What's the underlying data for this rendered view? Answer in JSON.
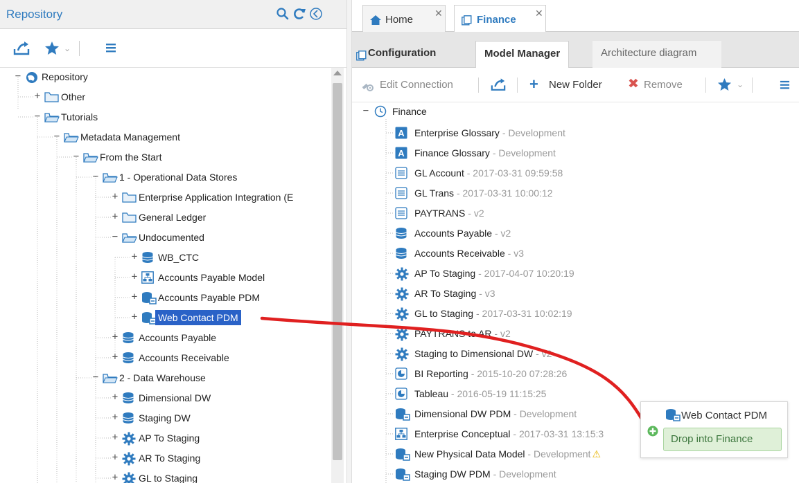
{
  "left_panel": {
    "title": "Repository",
    "tree": [
      {
        "label": "Repository",
        "icon": "repository-globe-icon"
      },
      {
        "label": "Other",
        "icon": "folder-icon"
      },
      {
        "label": "Tutorials",
        "icon": "folder-open-icon"
      },
      {
        "label": "Metadata Management",
        "icon": "folder-open-icon"
      },
      {
        "label": "From the Start",
        "icon": "folder-open-icon"
      },
      {
        "label": "1 - Operational Data Stores",
        "icon": "folder-open-icon"
      },
      {
        "label": "Enterprise Application Integration (E",
        "icon": "folder-icon"
      },
      {
        "label": "General Ledger",
        "icon": "folder-icon"
      },
      {
        "label": "Undocumented",
        "icon": "folder-open-icon"
      },
      {
        "label": "WB_CTC",
        "icon": "database-icon"
      },
      {
        "label": "Accounts Payable Model",
        "icon": "data-model-icon"
      },
      {
        "label": "Accounts Payable PDM",
        "icon": "physical-data-model-icon"
      },
      {
        "label": "Web Contact PDM",
        "icon": "physical-data-model-icon"
      },
      {
        "label": "Accounts Payable",
        "icon": "database-icon"
      },
      {
        "label": "Accounts Receivable",
        "icon": "database-icon"
      },
      {
        "label": "2 - Data Warehouse",
        "icon": "folder-open-icon"
      },
      {
        "label": "Dimensional DW",
        "icon": "database-icon"
      },
      {
        "label": "Staging DW",
        "icon": "database-icon"
      },
      {
        "label": "AP To Staging",
        "icon": "mapping-gear-icon"
      },
      {
        "label": "AR To Staging",
        "icon": "mapping-gear-icon"
      },
      {
        "label": "GL to Staging",
        "icon": "mapping-gear-icon"
      }
    ]
  },
  "right_panel": {
    "tabs": [
      {
        "label": "Home",
        "icon": "home-icon"
      },
      {
        "label": "Finance",
        "icon": "configuration-icon"
      }
    ],
    "subtabs": {
      "configuration": "Configuration",
      "model_manager": "Model Manager",
      "architecture": "Architecture diagram"
    },
    "toolbar": {
      "edit_connection": "Edit Connection",
      "new_folder": "New Folder",
      "remove": "Remove"
    },
    "root": "Finance",
    "items": [
      {
        "name": "Enterprise Glossary",
        "meta": " - Development",
        "icon": "glossary-icon"
      },
      {
        "name": "Finance Glossary",
        "meta": " - Development",
        "icon": "glossary-icon"
      },
      {
        "name": "GL Account",
        "meta": " - 2017-03-31 09:59:58",
        "icon": "file-icon"
      },
      {
        "name": "GL Trans",
        "meta": " - 2017-03-31 10:00:12",
        "icon": "file-icon"
      },
      {
        "name": "PAYTRANS",
        "meta": " - v2",
        "icon": "file-icon"
      },
      {
        "name": "Accounts Payable",
        "meta": " - v2",
        "icon": "database-icon"
      },
      {
        "name": "Accounts Receivable",
        "meta": " - v3",
        "icon": "database-icon"
      },
      {
        "name": "AP To Staging",
        "meta": " - 2017-04-07 10:20:19",
        "icon": "mapping-gear-icon"
      },
      {
        "name": "AR To Staging",
        "meta": " - v3",
        "icon": "mapping-gear-icon"
      },
      {
        "name": "GL to Staging",
        "meta": " - 2017-03-31 10:02:19",
        "icon": "mapping-gear-icon"
      },
      {
        "name": "PAYTRANS to AR",
        "meta": " - v2",
        "icon": "mapping-gear-icon"
      },
      {
        "name": "Staging to Dimensional DW",
        "meta": " - v2",
        "icon": "mapping-gear-icon"
      },
      {
        "name": "BI Reporting",
        "meta": " - 2015-10-20 07:28:26",
        "icon": "bi-report-icon"
      },
      {
        "name": "Tableau",
        "meta": " - 2016-05-19 11:15:25",
        "icon": "bi-report-icon"
      },
      {
        "name": "Dimensional DW PDM",
        "meta": " - Development",
        "icon": "physical-data-model-icon"
      },
      {
        "name": "Enterprise Conceptual",
        "meta": " - 2017-03-31 13:15:3",
        "icon": "data-model-icon"
      },
      {
        "name": "New Physical Data Model",
        "meta": " - Development",
        "icon": "physical-data-model-icon"
      },
      {
        "name": "Staging DW PDM",
        "meta": " - Development",
        "icon": "physical-data-model-icon"
      }
    ]
  },
  "drag": {
    "item_label": "Web Contact PDM",
    "drop_label": "Drop into Finance"
  },
  "colors": {
    "accent": "#2f7bbf",
    "selection": "#2a62c7",
    "drag_line": "#e02020",
    "drop_bg": "#dff0d8",
    "drop_text": "#3c763d"
  }
}
